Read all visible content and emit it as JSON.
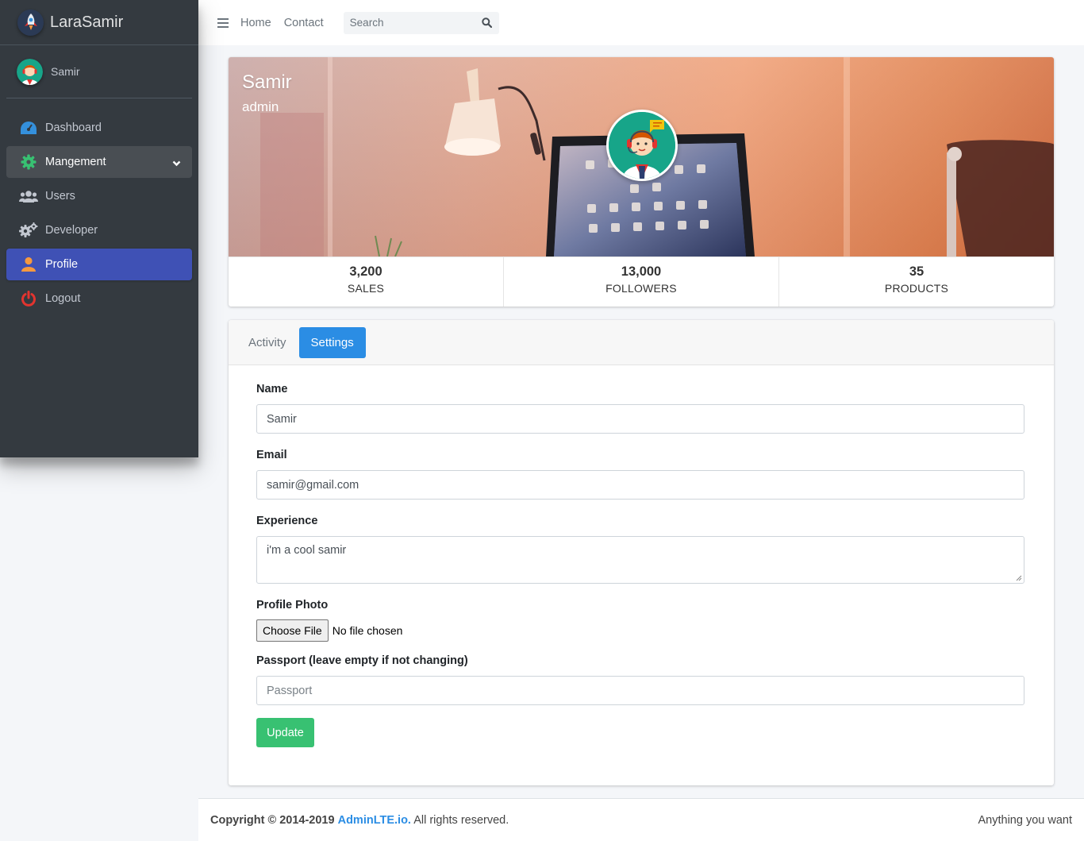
{
  "brand": {
    "name": "LaraSamir",
    "icon": "rocket-logo"
  },
  "user_panel": {
    "name": "Samir",
    "icon": "support-agent-avatar"
  },
  "sidebar": {
    "items": [
      {
        "label": "Dashboard",
        "icon": "tachometer-icon",
        "color": "#3490dc"
      },
      {
        "label": "Mangement",
        "icon": "cog-icon",
        "color": "#38c172",
        "expanded": true
      },
      {
        "label": "Users",
        "icon": "users-icon",
        "color": "#c2c7d0"
      },
      {
        "label": "Developer",
        "icon": "cogs-icon",
        "color": "#c2c7d0"
      },
      {
        "label": "Profile",
        "icon": "user-icon",
        "color": "#f6993f",
        "active": true
      },
      {
        "label": "Logout",
        "icon": "power-off-icon",
        "color": "#e3342f"
      }
    ]
  },
  "topbar": {
    "links": [
      "Home",
      "Contact"
    ],
    "search_placeholder": "Search"
  },
  "profile": {
    "name": "Samir",
    "role": "admin",
    "stats": [
      {
        "value": "3,200",
        "label": "SALES"
      },
      {
        "value": "13,000",
        "label": "FOLLOWERS"
      },
      {
        "value": "35",
        "label": "PRODUCTS"
      }
    ]
  },
  "tabs": {
    "activity": "Activity",
    "settings": "Settings",
    "active": "Settings"
  },
  "form": {
    "name_label": "Name",
    "name_value": "Samir",
    "email_label": "Email",
    "email_value": "samir@gmail.com",
    "experience_label": "Experience",
    "experience_value": "i'm a cool samir",
    "photo_label": "Profile Photo",
    "choose_file": "Choose File",
    "no_file": "No file chosen",
    "passport_label": "Passport (leave empty if not changing)",
    "passport_placeholder": "Passport",
    "update_button": "Update"
  },
  "footer": {
    "copyright_prefix": "Copyright © 2014-2019",
    "link": "AdminLTE.io.",
    "rights": "All rights reserved.",
    "right_text": "Anything you want"
  },
  "colors": {
    "sidebar_bg": "#343a40",
    "active_nav": "#3f51b5",
    "primary": "#2b8de4",
    "success": "#38c172"
  }
}
